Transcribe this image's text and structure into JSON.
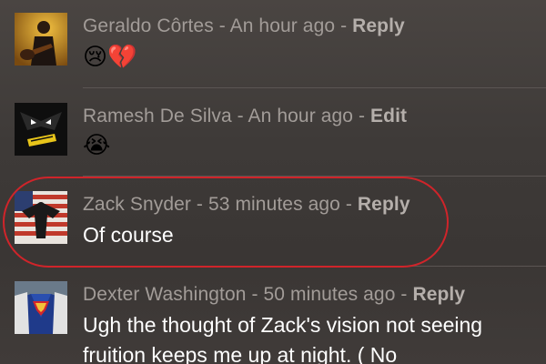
{
  "comments": [
    {
      "author": "Geraldo Côrtes",
      "time": "An hour ago",
      "action": "Reply",
      "emoji": "😢💔",
      "avatar_icon": "guitarist-avatar"
    },
    {
      "author": "Ramesh De Silva",
      "time": "An hour ago",
      "action": "Edit",
      "emoji": "😭",
      "avatar_icon": "dark-logo-avatar"
    },
    {
      "author": "Zack Snyder",
      "time": "53 minutes ago",
      "action": "Reply",
      "text": "Of course",
      "avatar_icon": "eagle-flag-avatar"
    },
    {
      "author": "Dexter Washington",
      "time": "50 minutes ago",
      "action": "Reply",
      "text": "Ugh the thought of Zack's vision not seeing fruition keeps me up at night. ( No",
      "avatar_icon": "superman-avatar"
    }
  ],
  "separator": " - ",
  "colors": {
    "highlight": "#d0242a",
    "meta_text": "#a29c98",
    "body_text": "#ffffff"
  }
}
